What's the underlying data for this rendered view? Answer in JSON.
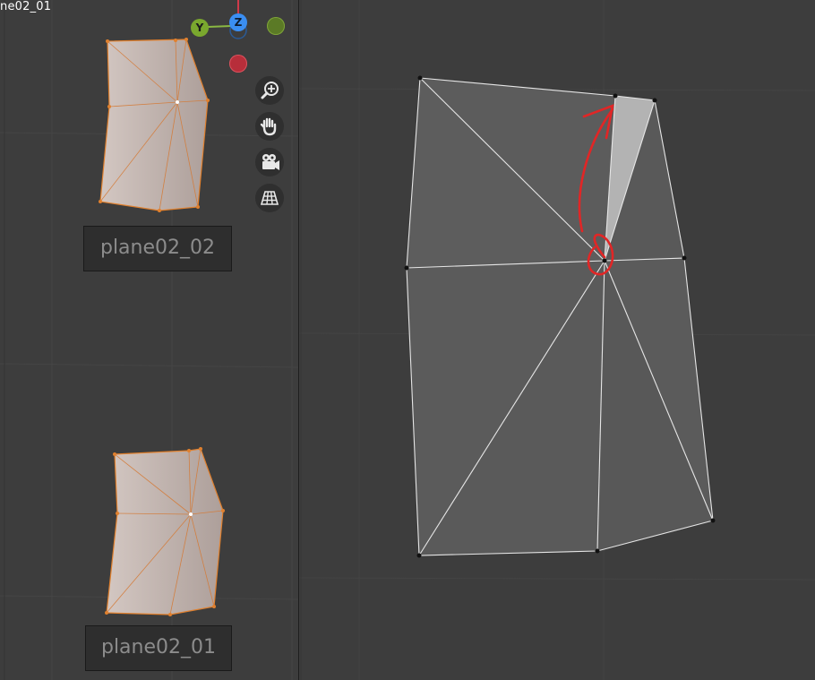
{
  "header": {
    "title_fragment": "ne02_01"
  },
  "objects": [
    {
      "name": "plane02_02"
    },
    {
      "name": "plane02_01"
    }
  ],
  "gizmo": {
    "axis_y": "Y",
    "axis_z": "Z",
    "colors": {
      "y": "#6f9a26",
      "z": "#3a8ef2",
      "x_neg": "#c0303b",
      "y_neg": "#5b7a26"
    }
  },
  "navigation": [
    {
      "icon": "zoom-in-icon"
    },
    {
      "icon": "hand-pan-icon"
    },
    {
      "icon": "camera-icon"
    },
    {
      "icon": "grid-icon"
    }
  ],
  "colors": {
    "edge_selected": "#e0802e",
    "face_selected": "#cfc2bc",
    "face_unselected": "#5d5d5d",
    "face_active": "#b5b5b5",
    "annotation": "#e12626"
  }
}
